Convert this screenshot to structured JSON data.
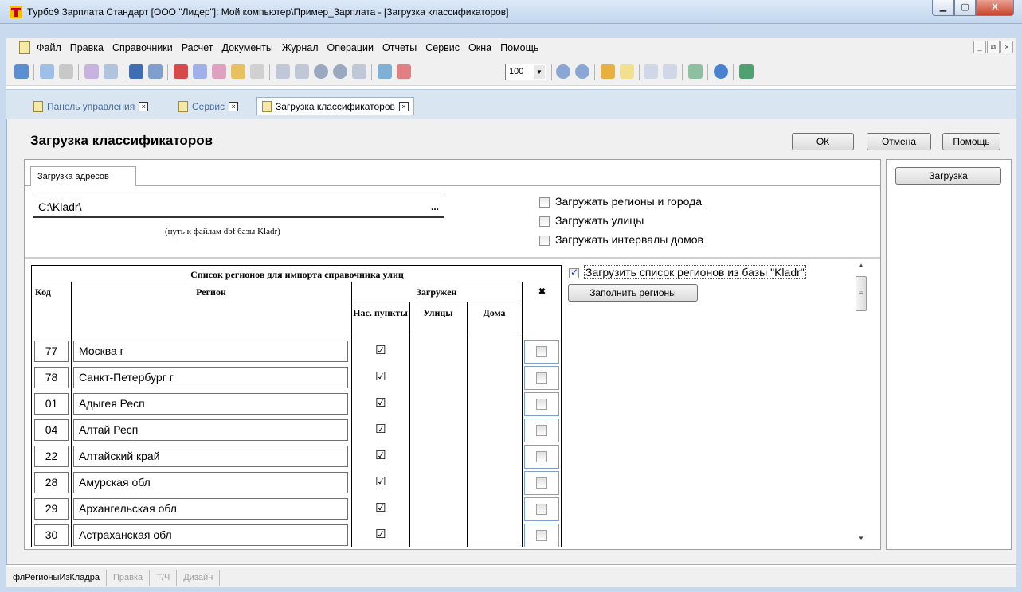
{
  "window": {
    "title": "Тyрбо9 Зарплата Стандарт [ООО \"Лидер\"]: Мой компьютер\\Пример_Зарплата - [Загрузка классификаторов]",
    "min_glyph": "▁",
    "max_glyph": "▢",
    "close_glyph": "X"
  },
  "menu": [
    "Файл",
    "Правка",
    "Справочники",
    "Расчет",
    "Документы",
    "Журнал",
    "Операции",
    "Отчеты",
    "Сервис",
    "Окна",
    "Помощь"
  ],
  "mdi": {
    "min": "_",
    "restore": "⧉",
    "close": "×"
  },
  "toolbar": {
    "zoom_value": "100"
  },
  "tabs": [
    {
      "label": "Панель управления",
      "close": "×"
    },
    {
      "label": "Сервис",
      "close": "×"
    },
    {
      "label": "Загрузка классификаторов",
      "close": "×"
    }
  ],
  "form": {
    "title": "Загрузка классификаторов",
    "ok": "ОК",
    "cancel": "Отмена",
    "help": "Помощь",
    "load": "Загрузка"
  },
  "addr_tab": "Загрузка адресов",
  "path": {
    "value": "C:\\Kladr\\",
    "dots": "...",
    "hint": "(путь к файлам dbf базы Kladr)"
  },
  "options": [
    {
      "label": "Загружать регионы и города",
      "checked": false
    },
    {
      "label": "Загружать улицы",
      "checked": false
    },
    {
      "label": "Загружать интервалы домов",
      "checked": false
    }
  ],
  "load_list": {
    "label": "Загрузить список регионов из базы \"Kladr\"",
    "checked": true
  },
  "fill_regions": "Заполнить регионы",
  "grid": {
    "title": "Список регионов для импорта справочника улиц",
    "col_code": "Код",
    "col_region": "Регион",
    "col_loaded": "Загружен",
    "col_places": "Нас. пункты",
    "col_streets": "Улицы",
    "col_houses": "Дома",
    "col_mark": "✖",
    "check_glyph": "☑",
    "rows": [
      {
        "code": "77",
        "region": "Москва г"
      },
      {
        "code": "78",
        "region": "Санкт-Петербург г"
      },
      {
        "code": "01",
        "region": "Адыгея Респ"
      },
      {
        "code": "04",
        "region": "Алтай Респ"
      },
      {
        "code": "22",
        "region": "Алтайский край"
      },
      {
        "code": "28",
        "region": "Амурская обл"
      },
      {
        "code": "29",
        "region": "Архангельская обл"
      },
      {
        "code": "30",
        "region": "Астраханская обл"
      }
    ]
  },
  "status": [
    "флРегионыИзКладра",
    "Правка",
    "Т/Ч",
    "Дизайн"
  ]
}
